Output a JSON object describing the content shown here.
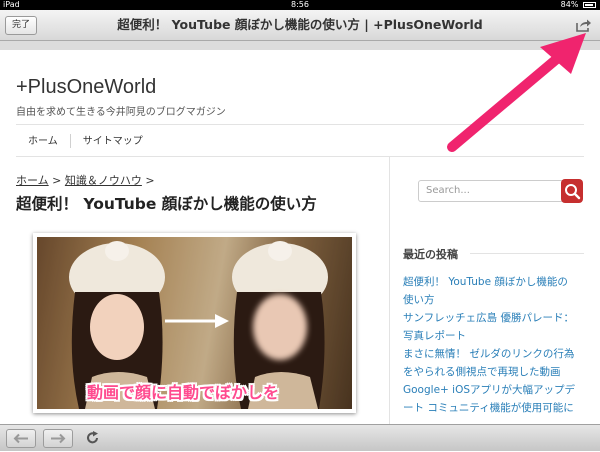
{
  "status_bar": {
    "device": "iPad",
    "time": "8:56",
    "battery_text": "84%",
    "battery_level": 0.84
  },
  "nav_bar": {
    "done_label": "完了",
    "title": "超便利！ YouTube 顔ぼかし機能の使い方 | +PlusOneWorld",
    "share_icon": "share-icon"
  },
  "site": {
    "title": "+PlusOneWorld",
    "description": "自由を求めて生きる今井阿見のブログマガジン",
    "menu": [
      "ホーム",
      "サイトマップ"
    ]
  },
  "breadcrumb": {
    "home": "ホーム",
    "sep1": ">",
    "category": "知識＆ノウハウ",
    "sep2": ">"
  },
  "post": {
    "title": "超便利！ YouTube 顔ぼかし機能の使い方",
    "image_caption": "動画で顔に自動でぼかしを"
  },
  "sidebar": {
    "search_placeholder": "Search...",
    "recent_title": "最近の投稿",
    "recent_posts": [
      "超便利！ YouTube 顔ぼかし機能の",
      "使い方",
      "サンフレッチェ広島 優勝パレード：",
      "写真レポート",
      "まさに無情！ ゼルダのリンクの行為",
      "をやられる側視点で再現した動画",
      "Google+ iOSアプリが大幅アップデ",
      "ート コミュニティ機能が使用可能に"
    ]
  },
  "toolbar": {
    "back_icon": "back-arrow-icon",
    "forward_icon": "forward-arrow-icon",
    "reload_icon": "reload-icon"
  },
  "colors": {
    "link": "#2a7fb8",
    "search_button": "#c62f2f",
    "annotation_arrow": "#f0246e",
    "caption": "#ff4b8f"
  }
}
